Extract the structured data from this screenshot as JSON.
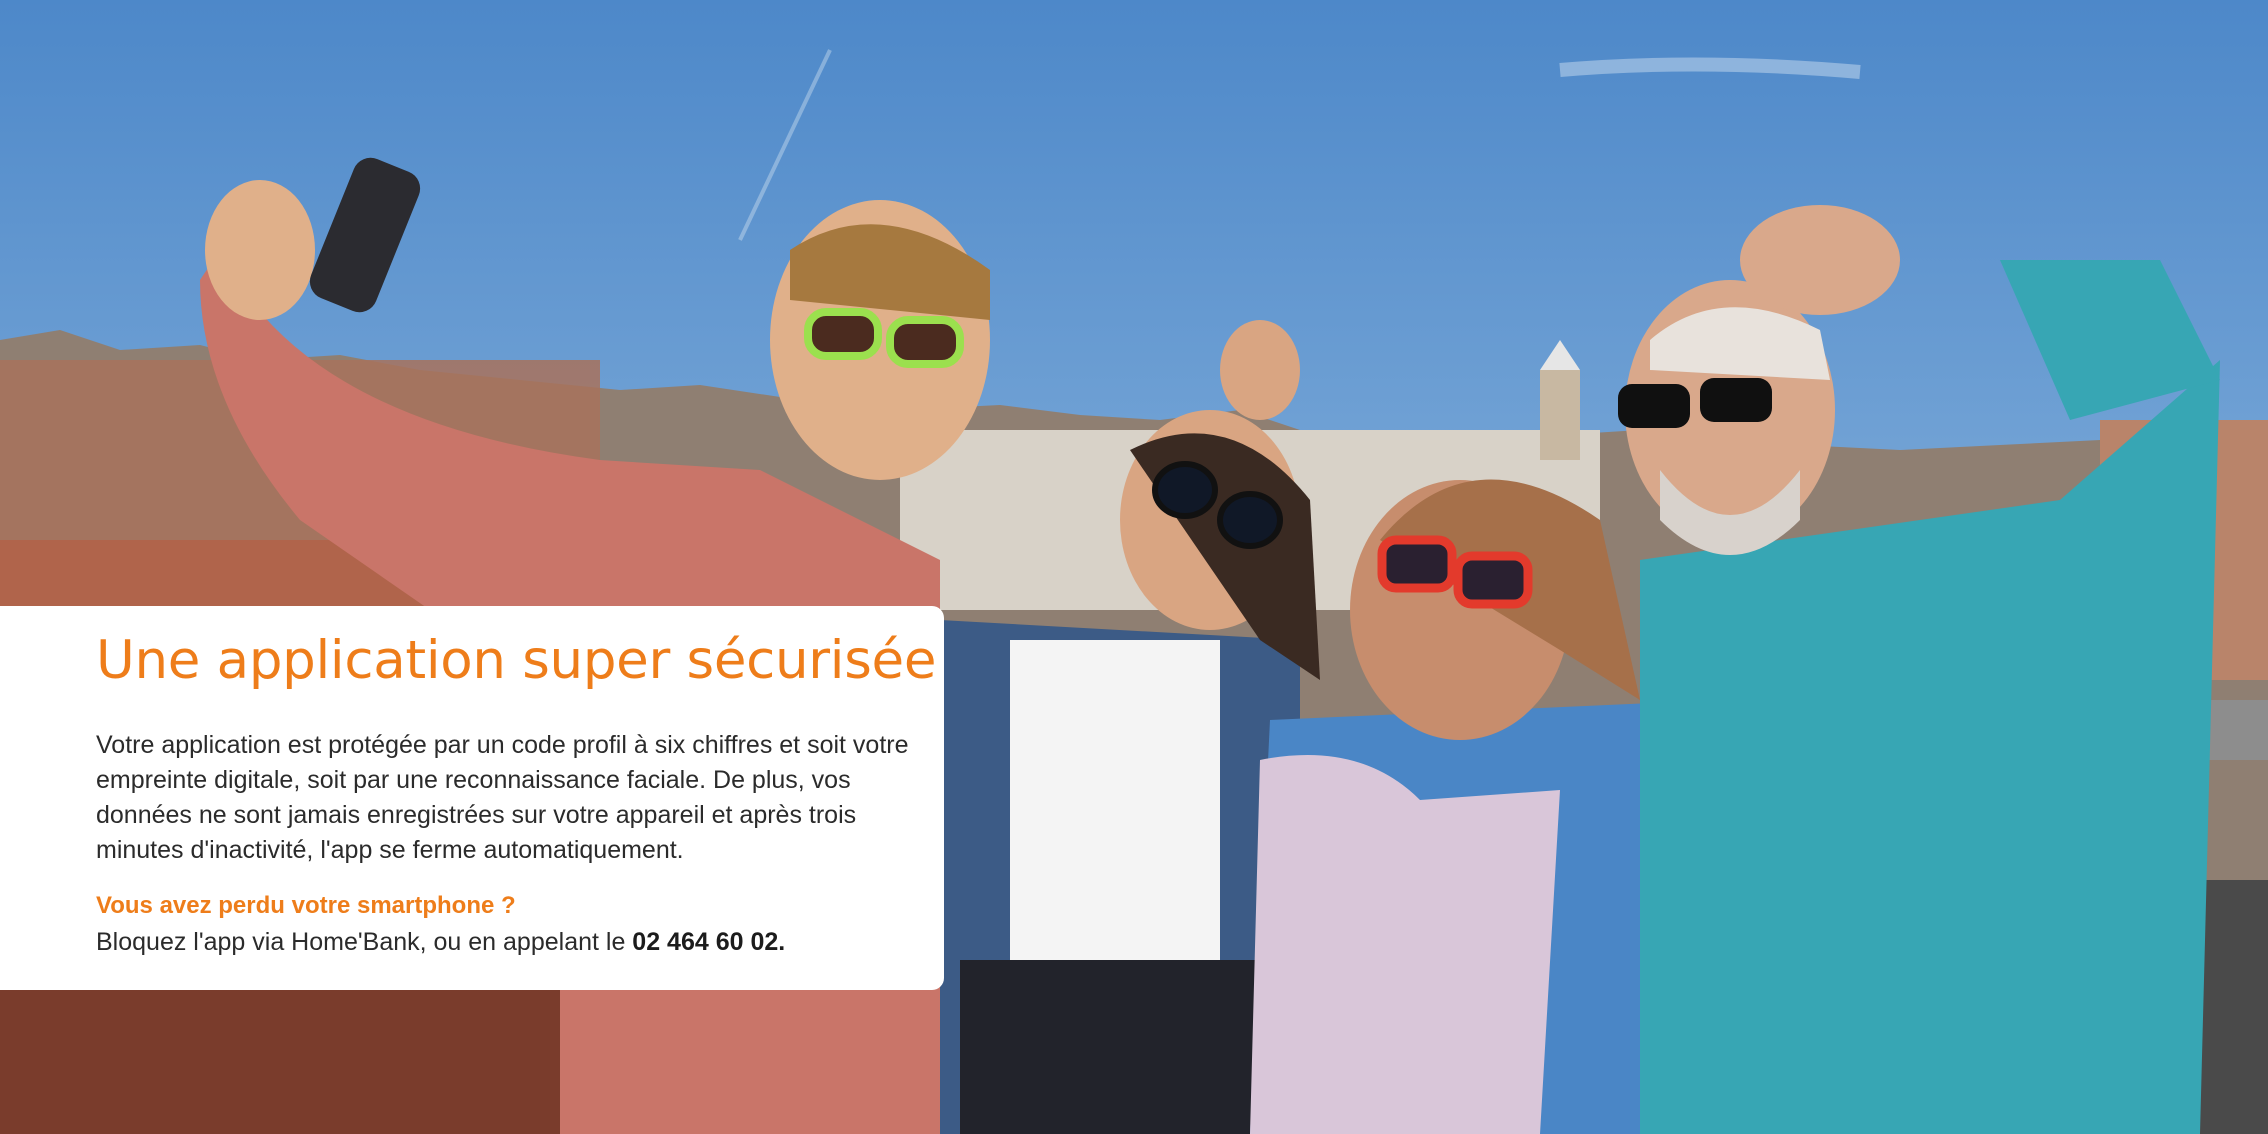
{
  "headline": "Une application super sécurisée",
  "body_text": "Votre application est protégée par un code profil à six chiffres et soit votre empreinte digitale, soit par une reconnaissance faciale. De plus, vos données ne sont jamais enregistrées sur votre appareil et après trois minutes d'inactivité, l'app se ferme automatiquement.",
  "lost_phone_question": "Vous avez perdu votre smartphone ?",
  "lost_phone_text": "Bloquez l'app via Home'Bank, ou en appelant le ",
  "phone_number": "02 464 60 02.",
  "colors": {
    "accent": "#ee7d1a",
    "text": "#2b2b2b",
    "card": "#ffffff"
  }
}
